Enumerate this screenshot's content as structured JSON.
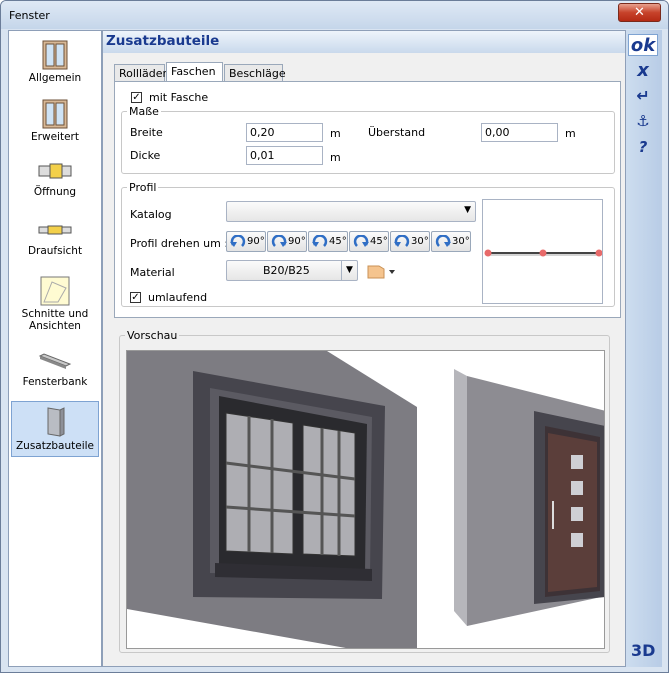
{
  "window": {
    "title": "Fenster",
    "close": "✕"
  },
  "sidebar": {
    "items": [
      {
        "label": "Allgemein",
        "icon": "window-icon"
      },
      {
        "label": "Erweitert",
        "icon": "window-extended-icon"
      },
      {
        "label": "Öffnung",
        "icon": "opening-icon"
      },
      {
        "label": "Draufsicht",
        "icon": "topview-icon"
      },
      {
        "label": "Schnitte und Ansichten",
        "icon": "section-icon"
      },
      {
        "label": "Fensterbank",
        "icon": "sill-icon"
      },
      {
        "label": "Zusatzbauteile",
        "icon": "addon-icon",
        "active": true
      }
    ]
  },
  "header": {
    "title": "Zusatzbauteile"
  },
  "tabs": [
    "Rollläden",
    "Faschen",
    "Beschläge"
  ],
  "active_tab": "Faschen",
  "panel": {
    "mit_fasche": {
      "label": "mit Fasche",
      "checked": true
    },
    "masse": {
      "title": "Maße",
      "breite_label": "Breite",
      "breite_value": "0,20",
      "breite_unit": "m",
      "dicke_label": "Dicke",
      "dicke_value": "0,01",
      "dicke_unit": "m",
      "ueberstand_label": "Überstand",
      "ueberstand_value": "0,00",
      "ueberstand_unit": "m"
    },
    "profil": {
      "title": "Profil",
      "katalog_label": "Katalog",
      "katalog_value": "",
      "drehen_label": "Profil drehen um :",
      "rotations": [
        "90°",
        "90°",
        "45°",
        "45°",
        "30°",
        "30°"
      ],
      "material_label": "Material",
      "material_value": "B20/B25",
      "umlaufend": {
        "label": "umlaufend",
        "checked": true
      }
    }
  },
  "preview": {
    "title": "Vorschau"
  },
  "toolbar": {
    "ok": "ok",
    "cancel": "x",
    "enter": "↵",
    "anchor": "⚓",
    "help": "?",
    "d3": "3D"
  },
  "colors": {
    "accent": "#1a3a8f",
    "wall": "#7d7c82",
    "frame": "#46454d",
    "profile_point": "#e86a6a"
  }
}
